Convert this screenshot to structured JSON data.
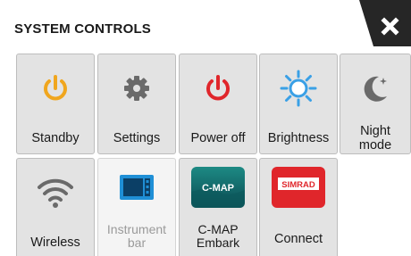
{
  "header": {
    "title": "SYSTEM CONTROLS"
  },
  "tiles": [
    {
      "label": "Standby",
      "icon": "power-standby-icon",
      "color": "#f0a61e"
    },
    {
      "label": "Settings",
      "icon": "gear-icon",
      "color": "#6a6a6a"
    },
    {
      "label": "Power off",
      "icon": "power-icon",
      "color": "#e0262b"
    },
    {
      "label": "Brightness",
      "icon": "sun-icon",
      "color": "#3aa0e6"
    },
    {
      "label": "Night mode",
      "icon": "moon-icon",
      "color": "#6a6a6a"
    },
    {
      "label": "Wireless",
      "icon": "wifi-icon",
      "color": "#6a6a6a"
    },
    {
      "label": "Instrument bar",
      "icon": "instrument-bar-icon",
      "color": "#1f8fd6",
      "disabled": true
    },
    {
      "label": "C-MAP Embark",
      "icon": "cmap-logo-icon",
      "badge": "C-MAP",
      "color": "#0d6d6a"
    },
    {
      "label": "Connect",
      "icon": "simrad-logo-icon",
      "badge": "SIMRAD",
      "color": "#e0262b"
    }
  ]
}
